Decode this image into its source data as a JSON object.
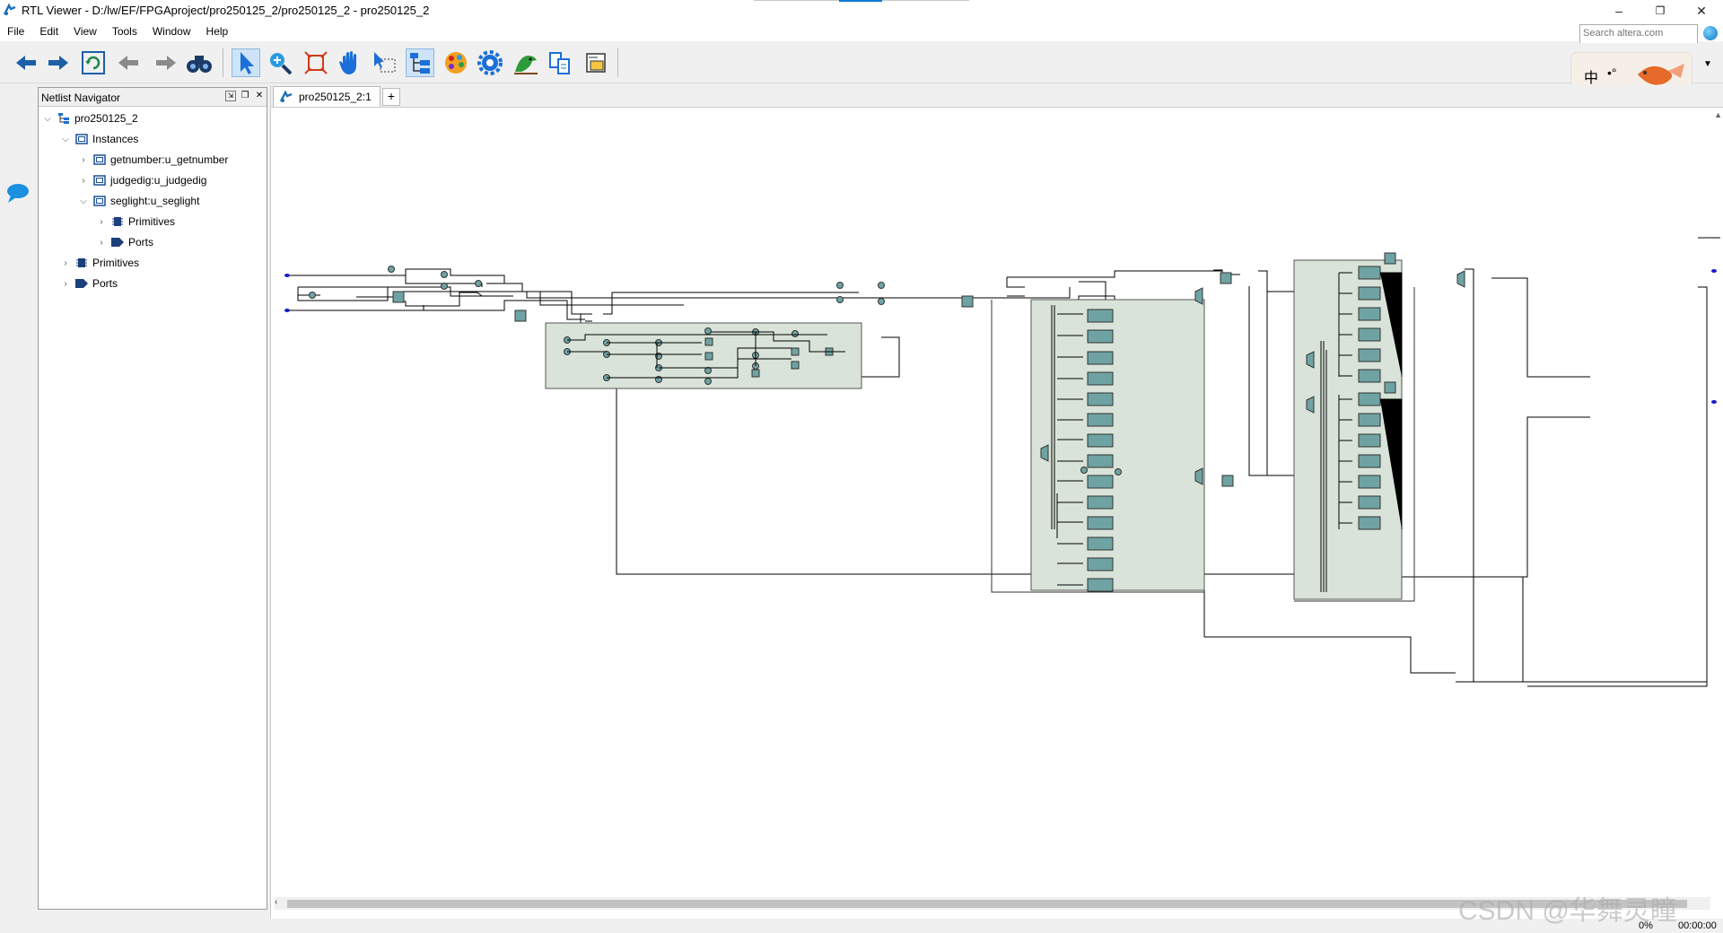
{
  "window": {
    "title": "RTL Viewer - D:/lw/EF/FPGAproject/pro250125_2/pro250125_2 - pro250125_2",
    "minimize_glyph": "–",
    "restore_glyph": "❐",
    "close_glyph": "✕"
  },
  "menu": [
    "File",
    "Edit",
    "View",
    "Tools",
    "Window",
    "Help"
  ],
  "search": {
    "placeholder": "Search altera.com"
  },
  "toolbar": {
    "buttons": [
      "back-icon",
      "forward-icon",
      "refresh-icon",
      "previous-icon",
      "next-icon",
      "binoculars-icon",
      "select-pointer-icon",
      "zoom-icon",
      "fit-window-icon",
      "hand-pan-icon",
      "area-select-icon",
      "hierarchy-netlist-icon",
      "color-palette-icon",
      "settings-gear-icon",
      "bird-icon",
      "export-icon",
      "print-icon"
    ],
    "active_button": "select-pointer-icon"
  },
  "ime_bar": {
    "char": "中"
  },
  "navigator": {
    "title": "Netlist Navigator",
    "tree": [
      {
        "label": "pro250125_2",
        "icon": "hierarchy-icon",
        "expanded": true
      },
      {
        "label": "Instances",
        "icon": "instance-icon",
        "expanded": true
      },
      {
        "label": "getnumber:u_getnumber",
        "icon": "instance-icon",
        "expanded": false
      },
      {
        "label": "judgedig:u_judgedig",
        "icon": "instance-icon",
        "expanded": false
      },
      {
        "label": "seglight:u_seglight",
        "icon": "instance-icon",
        "expanded": true
      },
      {
        "label": "Primitives",
        "icon": "primitive-icon",
        "expanded": false
      },
      {
        "label": "Ports",
        "icon": "port-icon",
        "expanded": false
      },
      {
        "label": "Primitives",
        "icon": "primitive-icon",
        "expanded": false
      },
      {
        "label": "Ports",
        "icon": "port-icon",
        "expanded": false
      }
    ]
  },
  "document_tab": {
    "label": "pro250125_2:1",
    "add_label": "+"
  },
  "status": {
    "progress_label": "0%",
    "progress": 0,
    "elapsed": "00:00:00"
  },
  "watermark": "CSDN @华舞灵瞳",
  "colors": {
    "block_fill": "#d9e3d9",
    "cell_fill": "#6fa3a3",
    "wire": "#000000",
    "port": "#1a1acc",
    "accent": "#0078d7"
  }
}
